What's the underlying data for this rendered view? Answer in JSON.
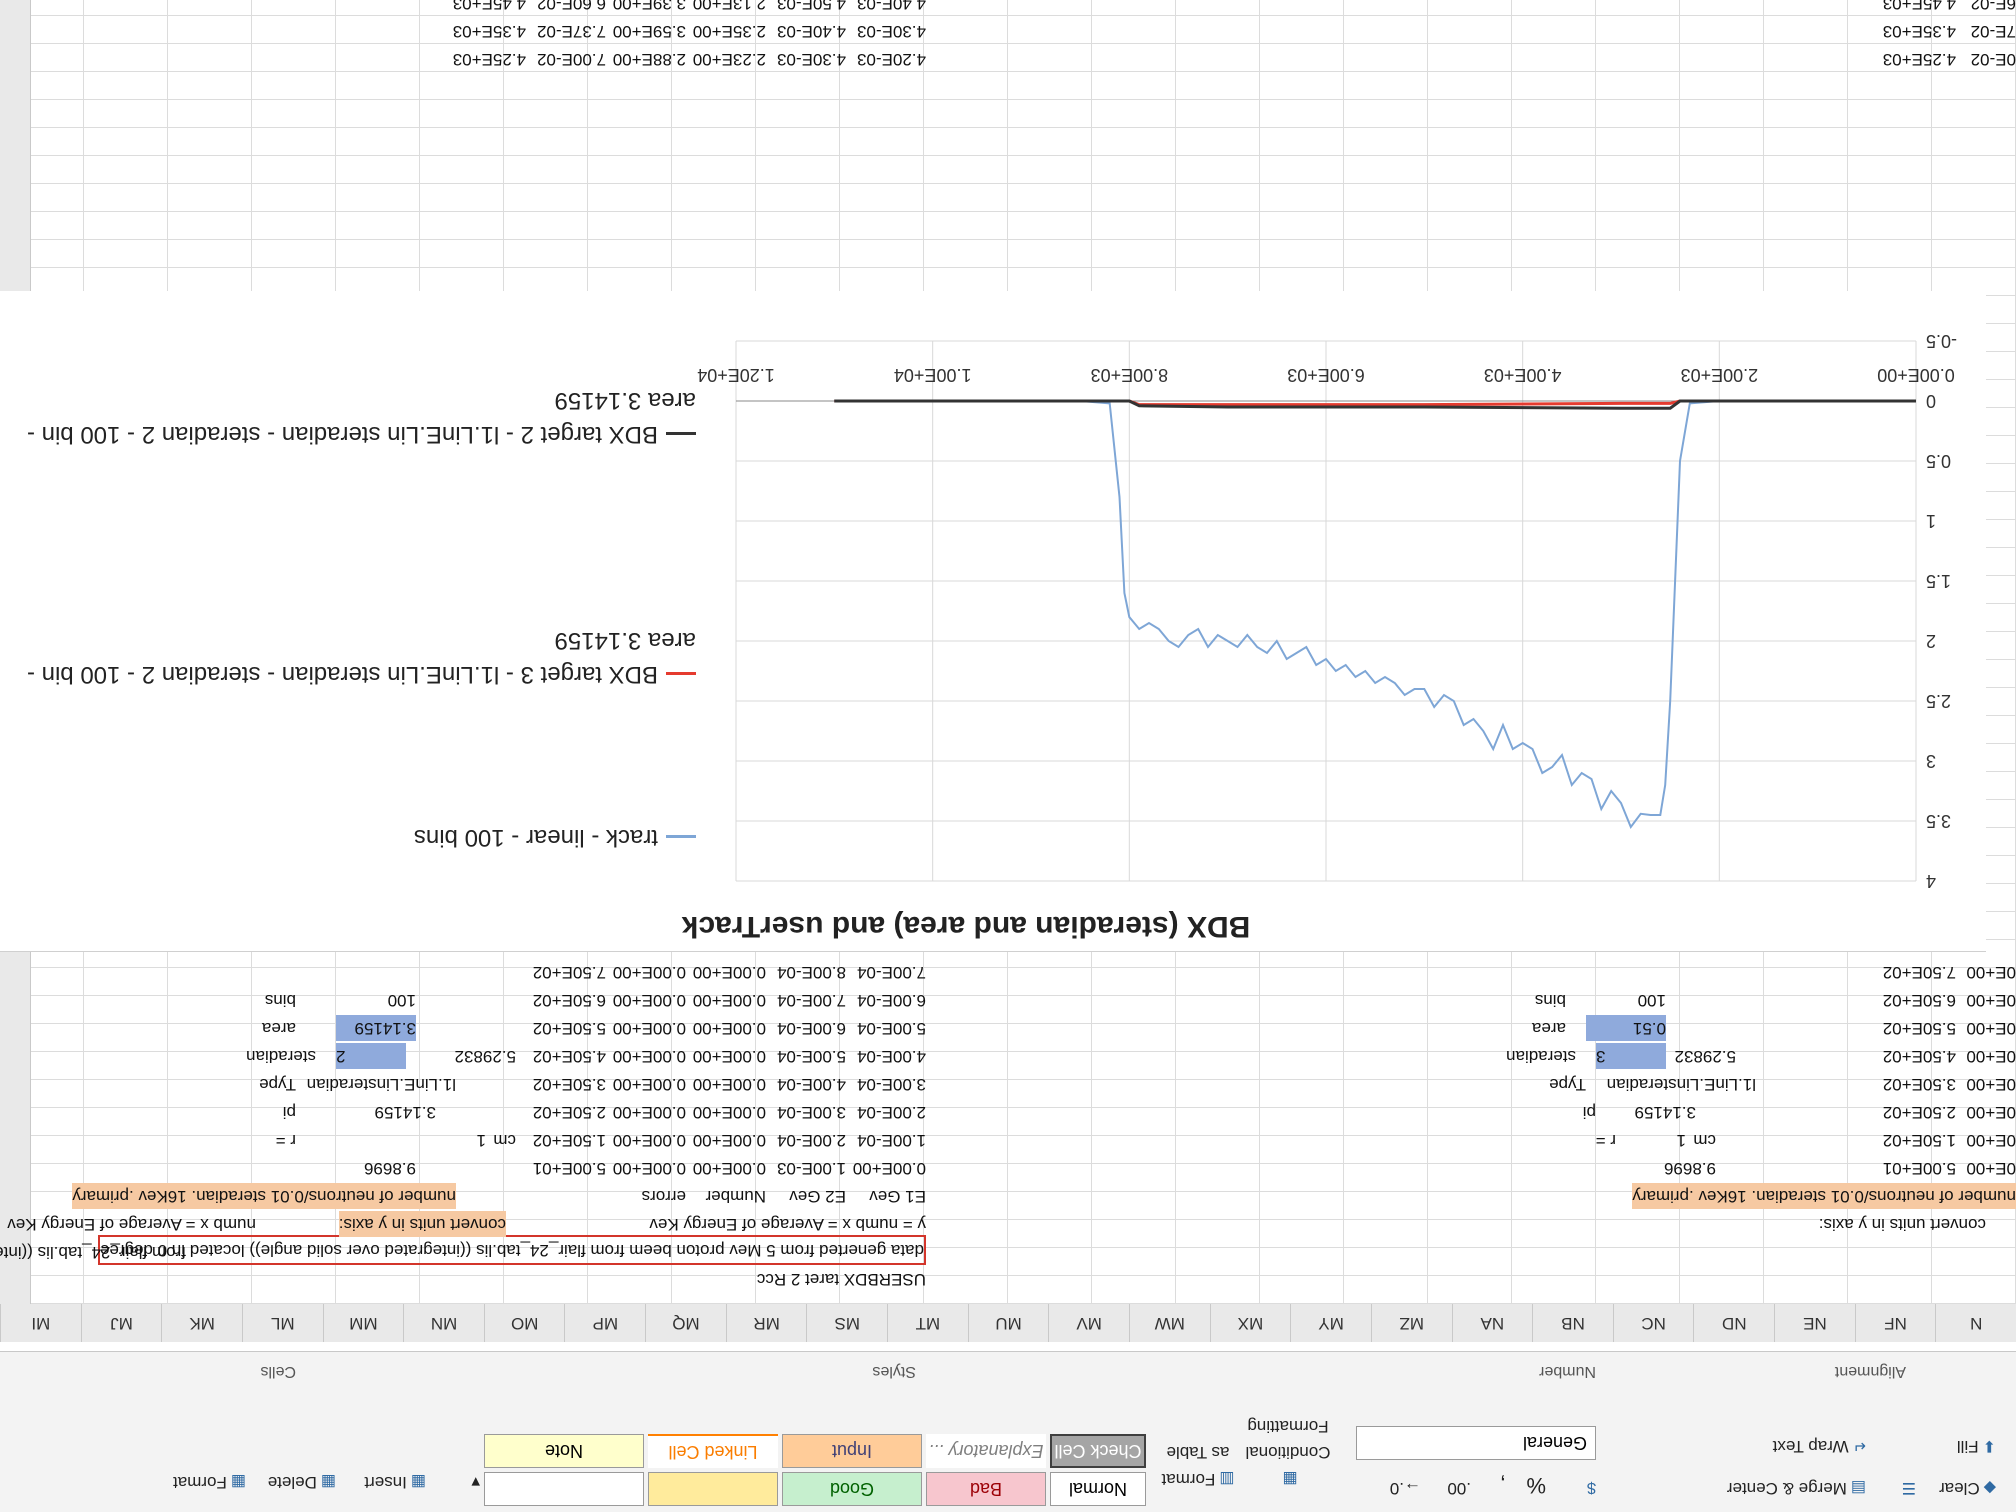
{
  "ribbon": {
    "wrap_text": "Wrap Text",
    "merge_center": "Merge & Center",
    "number_format": "General",
    "percent": "%",
    "comma": ",",
    "dec_inc": ".00",
    "dec_dec": "→.0",
    "conditional_formatting": "Conditional Formatting",
    "format_as_table": "Format as Table",
    "style_normal": "Normal",
    "style_bad": "Bad",
    "style_good": "Good",
    "style_check_cell": "Check Cell",
    "style_explanatory": "Explanatory ...",
    "style_input": "Input",
    "style_linked_cell": "Linked Cell",
    "style_note": "Note",
    "insert": "Insert",
    "delete": "Delete",
    "format": "Format",
    "fill": "Fill",
    "clear": "Clear",
    "group_alignment": "Alignment",
    "group_number": "Number",
    "group_styles": "Styles",
    "group_cells": "Cells"
  },
  "columns": [
    "N",
    "NF",
    "NE",
    "ND",
    "NC",
    "NB",
    "NA",
    "MZ",
    "MY",
    "MX",
    "MW",
    "MV",
    "MU",
    "MT",
    "MS",
    "MR",
    "MQ",
    "MP",
    "MO",
    "MN",
    "MM",
    "ML",
    "MK",
    "MJ",
    "MI"
  ],
  "sheet": {
    "title_cell": "USERBDX taret 2 Rcc",
    "note_left": "data generted from 5 Mev proton beem from flair_24_tab.lis ((integrated over solid angle)) located in 0 degree",
    "note_right": "from flair_24_tab.lis ((integrated over solid angle)) located in 0 degree",
    "convert_x": "numb x = Average of Energy Kev",
    "convert_y": "convert units in y axis:",
    "y_eq": "y = numb x = Average of Energy Kev",
    "convert_y2": "convert units in y axis:",
    "num_neutrons": "number of neutrons/0.01 steradian. 16Kev .primary",
    "num_neutrons2": "number of neutrons/0.01 steradian. 16Kev .primary",
    "hdr_e1": "E1 Gev",
    "hdr_e2": "E2 Gev",
    "hdr_num": "Number",
    "hdr_err": "errors",
    "r_label": "r =",
    "r_val": "1",
    "r_unit": "cm",
    "pi_label": "pi",
    "pi_val": "3.14159",
    "type_label": "Type",
    "type_val": "l1.LinE.Linsteradian",
    "ster_label": "steradian",
    "ster_idx": "2",
    "ster_val": "5.29832",
    "area_label": "area",
    "area_val": "3.14159",
    "bins_label": "bins",
    "bins_val": "100",
    "r_label2": "r =",
    "r_val2": "1",
    "r_unit2": "cm",
    "pi_label2": "pi",
    "pi_val2": "3.14159",
    "type_label2": "Type",
    "type_val2": "l1.LinE.Linsteradian",
    "ster_label2": "steradian",
    "ster_idx2": "3",
    "ster_val2": "5.29832",
    "area_label2": "area",
    "area_val2": "0.51",
    "bins_label2": "bins",
    "bins_val2": "100",
    "val_9_8696": "9.8696",
    "val_9_8696b": "9.8696",
    "table": [
      [
        "0.00E+00",
        "1.00E-03",
        "0.00E+00",
        "0.00E+00",
        "5.00E+01"
      ],
      [
        "1.00E-04",
        "2.00E-04",
        "0.00E+00",
        "0.00E+00",
        "1.50E+02"
      ],
      [
        "2.00E-04",
        "3.00E-04",
        "0.00E+00",
        "0.00E+00",
        "2.50E+02"
      ],
      [
        "3.00E-04",
        "4.00E-04",
        "0.00E+00",
        "0.00E+00",
        "3.50E+02"
      ],
      [
        "4.00E-04",
        "5.00E-04",
        "0.00E+00",
        "0.00E+00",
        "4.50E+02"
      ],
      [
        "5.00E-04",
        "6.00E-04",
        "0.00E+00",
        "0.00E+00",
        "5.50E+02"
      ],
      [
        "6.00E-04",
        "7.00E-04",
        "0.00E+00",
        "0.00E+00",
        "6.50E+02"
      ],
      [
        "7.00E-04",
        "8.00E-04",
        "0.00E+00",
        "0.00E+00",
        "7.50E+02"
      ]
    ],
    "left_col": [
      "0E+00",
      "0E+00",
      "0E+00",
      "0E+00",
      "0E+00",
      "0E+00",
      "0E+00",
      "0E+00"
    ],
    "left_col2": [
      "5.00E+01",
      "1.50E+02",
      "2.50E+02",
      "3.50E+02",
      "4.50E+02",
      "5.50E+02",
      "6.50E+02",
      "7.50E+02"
    ],
    "bottom_table": [
      [
        "4.20E-03",
        "4.30E-03",
        "2.23E+00",
        "2.88E+00",
        "7.00E-02",
        "4.25E+03"
      ],
      [
        "4.30E-03",
        "4.40E-03",
        "2.35E+00",
        "3.59E+00",
        "7.37E-02",
        "4.35E+03"
      ],
      [
        "4.40E-03",
        "4.50E-03",
        "2.13E+00",
        "3.39E+00",
        "6.60E-02",
        "4.45E+03"
      ]
    ],
    "bottom_left": [
      "0E-02",
      "7E-02",
      "6E-02"
    ],
    "bottom_left2": [
      "4.25E+03",
      "4.35E+03",
      "4.45E+03"
    ]
  },
  "chart_data": {
    "type": "line",
    "title": "BDX (steradian and area) and userTrack",
    "xlabel": "",
    "ylabel": "",
    "xlim": [
      0,
      12000
    ],
    "ylim": [
      -0.5,
      4
    ],
    "x_ticks": [
      "0.00E+00",
      "2.00E+03",
      "4.00E+03",
      "6.00E+03",
      "8.00E+03",
      "1.00E+04",
      "1.20E+04"
    ],
    "y_ticks": [
      "-0.5",
      "0",
      "0.5",
      "1",
      "1.5",
      "2",
      "2.5",
      "3",
      "3.5",
      "4"
    ],
    "legend_position": "right",
    "series": [
      {
        "name": "track - linear - 100 bins",
        "color": "#7ea6d6",
        "x": [
          50,
          500,
          1000,
          1500,
          2000,
          2300,
          2400,
          2450,
          2500,
          2550,
          2600,
          2700,
          2800,
          2900,
          3000,
          3100,
          3200,
          3300,
          3400,
          3500,
          3600,
          3700,
          3800,
          3900,
          4000,
          4100,
          4200,
          4300,
          4400,
          4500,
          4600,
          4700,
          4800,
          4900,
          5000,
          5100,
          5200,
          5300,
          5400,
          5500,
          5600,
          5700,
          5800,
          5900,
          6000,
          6100,
          6200,
          6300,
          6400,
          6500,
          6600,
          6700,
          6800,
          6900,
          7000,
          7100,
          7200,
          7300,
          7400,
          7500,
          7600,
          7700,
          7800,
          7900,
          8000,
          8050,
          8100,
          8200,
          8500,
          9000,
          10000,
          11000
        ],
        "values": [
          0,
          0,
          0,
          0,
          0,
          0.02,
          0.5,
          1.5,
          2.5,
          3.2,
          3.45,
          3.45,
          3.44,
          3.55,
          3.35,
          3.25,
          3.4,
          3.15,
          3.1,
          3.2,
          2.95,
          3.05,
          3.1,
          2.9,
          2.85,
          2.9,
          2.7,
          2.9,
          2.75,
          2.65,
          2.7,
          2.5,
          2.45,
          2.55,
          2.4,
          2.4,
          2.45,
          2.35,
          2.3,
          2.35,
          2.25,
          2.3,
          2.2,
          2.25,
          2.15,
          2.2,
          2.05,
          2.1,
          2.15,
          2.0,
          2.1,
          2.05,
          1.95,
          2.05,
          2.0,
          1.95,
          2.05,
          1.9,
          1.95,
          2.05,
          2.0,
          1.9,
          1.85,
          1.9,
          1.8,
          1.6,
          0.8,
          0.02,
          0,
          0,
          0,
          0
        ]
      },
      {
        "name": "BDX target 3 - l1.LinE.Lin steradian - steradian 2 - 100 bin - area 3.14159",
        "color": "#e53b2f",
        "x": [
          0,
          2000,
          2400,
          2500,
          3000,
          5000,
          7000,
          7900,
          8000,
          8100,
          9000,
          11000
        ],
        "values": [
          0,
          0,
          0,
          0.02,
          0.02,
          0.03,
          0.03,
          0.03,
          0,
          0,
          0,
          0
        ]
      },
      {
        "name": "BDX target 2 - l1.LinE.Lin steradian - steradian 2 - 100 bin - area 3.14159",
        "color": "#333333",
        "x": [
          0,
          2000,
          2400,
          2500,
          3000,
          5000,
          7000,
          7900,
          8000,
          8100,
          9000,
          11000
        ],
        "values": [
          0,
          0,
          0,
          0.06,
          0.06,
          0.05,
          0.05,
          0.04,
          0,
          0,
          0,
          0
        ]
      }
    ]
  }
}
